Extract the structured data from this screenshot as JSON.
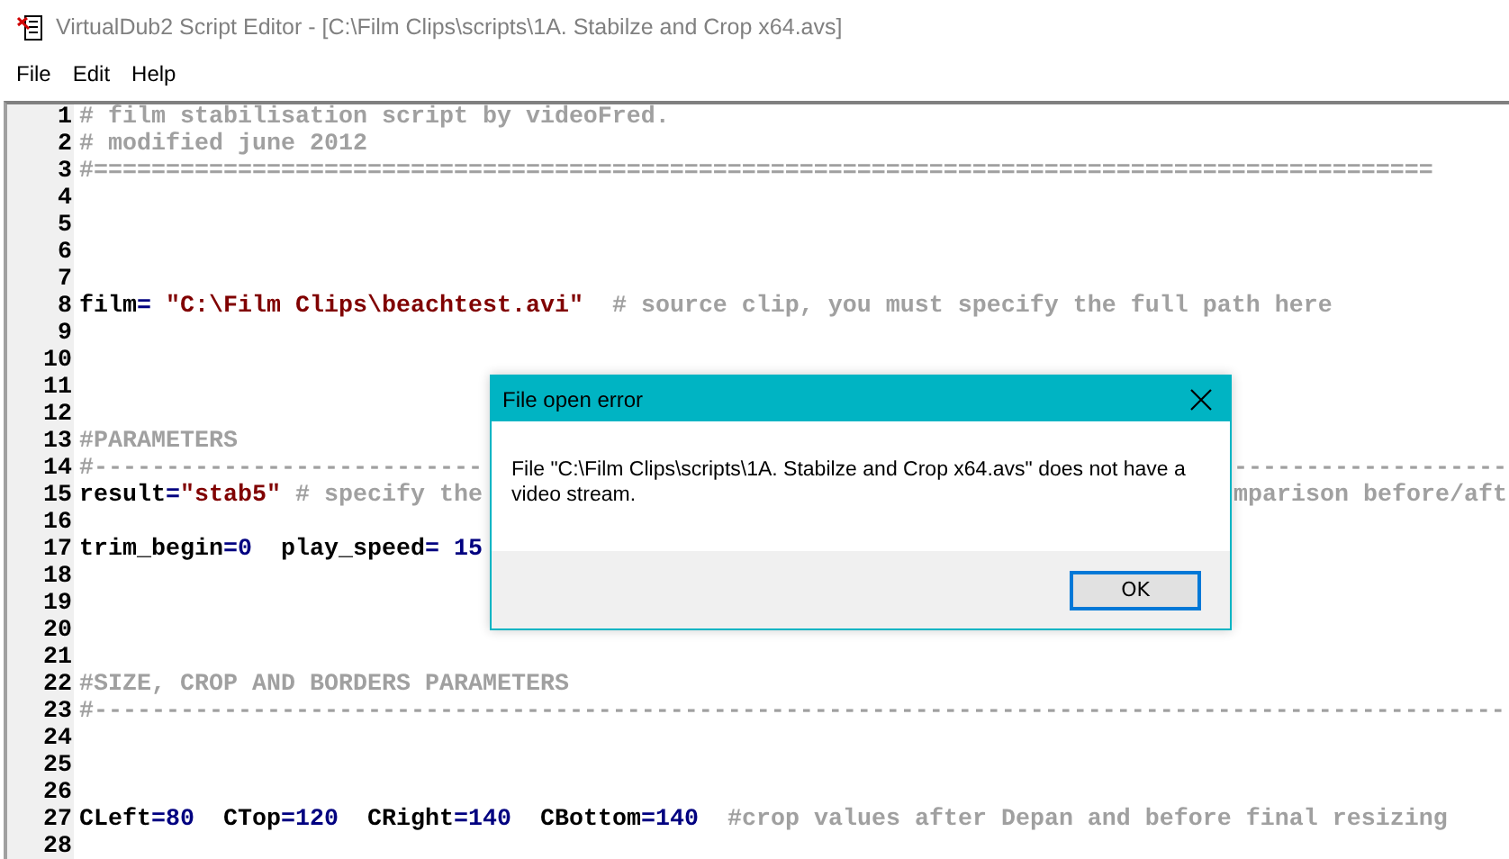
{
  "window": {
    "title": "VirtualDub2 Script Editor - [C:\\Film Clips\\scripts\\1A. Stabilze and Crop x64.avs]"
  },
  "menu": [
    {
      "label": "File"
    },
    {
      "label": "Edit"
    },
    {
      "label": "Help"
    }
  ],
  "editor": {
    "lines": [
      {
        "number": "1",
        "tokens": [
          {
            "kind": "comment",
            "text": "# film stabilisation script by videoFred."
          }
        ]
      },
      {
        "number": "2",
        "tokens": [
          {
            "kind": "comment",
            "text": "# modified june 2012"
          }
        ]
      },
      {
        "number": "3",
        "tokens": [
          {
            "kind": "comment",
            "text": "#============================================================================================="
          }
        ]
      },
      {
        "number": "4"
      },
      {
        "number": "5"
      },
      {
        "number": "6"
      },
      {
        "number": "7"
      },
      {
        "number": "8",
        "tokens": [
          {
            "kind": "text",
            "text": "film"
          },
          {
            "kind": "op",
            "text": "= "
          },
          {
            "kind": "string",
            "text": "\"C:\\Film Clips\\beachtest.avi\""
          },
          {
            "kind": "comment",
            "text": "  # source clip, you must specify the full path here"
          }
        ]
      },
      {
        "number": "9"
      },
      {
        "number": "10"
      },
      {
        "number": "11"
      },
      {
        "number": "12"
      },
      {
        "number": "13",
        "tokens": [
          {
            "kind": "comment",
            "text": "#PARAMETERS"
          }
        ]
      },
      {
        "number": "14",
        "tokens": [
          {
            "kind": "comment",
            "text": "#---------------------------"
          }
        ],
        "after": [
          {
            "kind": "comment",
            "text": "-------------------"
          }
        ]
      },
      {
        "number": "15",
        "tokens": [
          {
            "kind": "text",
            "text": "result"
          },
          {
            "kind": "op",
            "text": "="
          },
          {
            "kind": "string",
            "text": "\"stab5\""
          },
          {
            "kind": "comment",
            "text": " # specify the"
          }
        ],
        "after": [
          {
            "kind": "comment",
            "text": "mparison before/aft"
          }
        ]
      },
      {
        "number": "16"
      },
      {
        "number": "17",
        "tokens": [
          {
            "kind": "text",
            "text": "trim_begin"
          },
          {
            "kind": "op",
            "text": "="
          },
          {
            "kind": "number",
            "text": "0"
          },
          {
            "kind": "text",
            "text": "  play_speed"
          },
          {
            "kind": "op",
            "text": "= "
          },
          {
            "kind": "number",
            "text": "15"
          }
        ]
      },
      {
        "number": "18"
      },
      {
        "number": "19"
      },
      {
        "number": "20"
      },
      {
        "number": "21"
      },
      {
        "number": "22",
        "tokens": [
          {
            "kind": "comment",
            "text": "#SIZE, CROP AND BORDERS PARAMETERS"
          }
        ]
      },
      {
        "number": "23",
        "tokens": [
          {
            "kind": "comment",
            "text": "#--------------------------------------------------------------------------------------------------"
          }
        ]
      },
      {
        "number": "24"
      },
      {
        "number": "25"
      },
      {
        "number": "26"
      },
      {
        "number": "27",
        "tokens": [
          {
            "kind": "text",
            "text": "CLeft"
          },
          {
            "kind": "op",
            "text": "="
          },
          {
            "kind": "number",
            "text": "80"
          },
          {
            "kind": "text",
            "text": "  CTop"
          },
          {
            "kind": "op",
            "text": "="
          },
          {
            "kind": "number",
            "text": "120"
          },
          {
            "kind": "text",
            "text": "  CRight"
          },
          {
            "kind": "op",
            "text": "="
          },
          {
            "kind": "number",
            "text": "140"
          },
          {
            "kind": "text",
            "text": "  CBottom"
          },
          {
            "kind": "op",
            "text": "="
          },
          {
            "kind": "number",
            "text": "140"
          },
          {
            "kind": "comment",
            "text": "  #crop values after Depan and before final resizing"
          }
        ]
      },
      {
        "number": "28"
      }
    ]
  },
  "dialog": {
    "title": "File open error",
    "message": "File \"C:\\Film Clips\\scripts\\1A. Stabilze and Crop x64.avs\" does not have a video stream.",
    "buttons": [
      {
        "label": "OK"
      }
    ]
  }
}
